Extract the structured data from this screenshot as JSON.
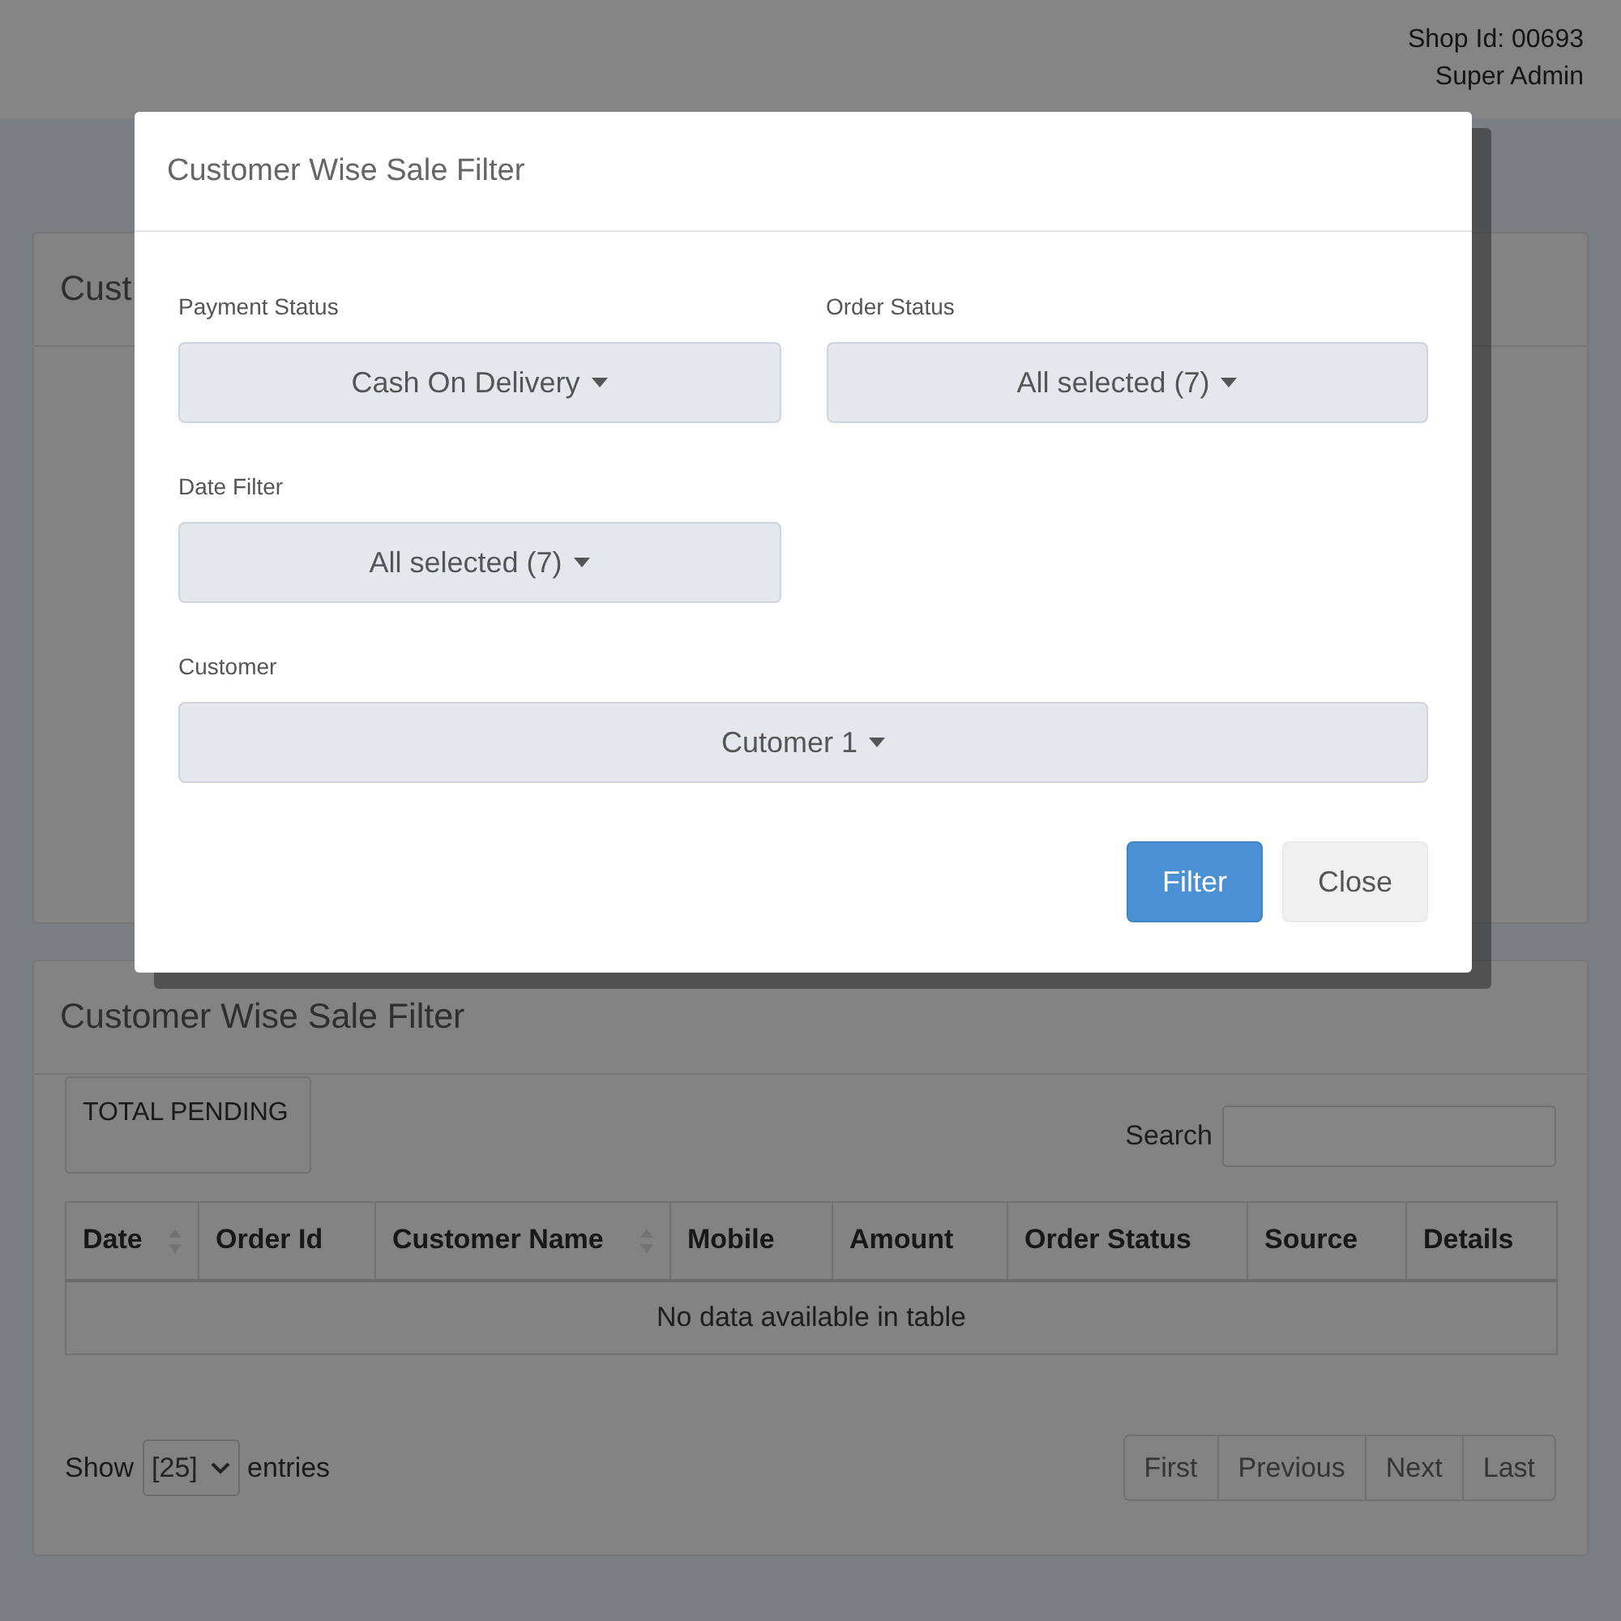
{
  "header": {
    "shop_id": "Shop Id: 00693",
    "role": "Super Admin"
  },
  "background_card": {
    "title": "Cust"
  },
  "report": {
    "title": "Customer Wise Sale Filter",
    "summary": "TOTAL PENDING",
    "search": {
      "label": "Search"
    },
    "table": {
      "columns": [
        {
          "label": "Date",
          "sortable": true
        },
        {
          "label": "Order Id",
          "sortable": false
        },
        {
          "label": "Customer Name",
          "sortable": true
        },
        {
          "label": "Mobile",
          "sortable": false
        },
        {
          "label": "Amount",
          "sortable": false
        },
        {
          "label": "Order Status",
          "sortable": false
        },
        {
          "label": "Source",
          "sortable": false
        },
        {
          "label": "Details",
          "sortable": false
        }
      ],
      "empty_message": "No data available in table"
    },
    "page_size": {
      "prefix": "Show",
      "value": "[25]",
      "suffix": "entries"
    },
    "pagination": [
      "First",
      "Previous",
      "Next",
      "Last"
    ]
  },
  "modal": {
    "title": "Customer Wise Sale Filter",
    "fields": [
      {
        "label": "Payment Status",
        "value": "Cash On Delivery",
        "wide": false
      },
      {
        "label": "Order Status",
        "value": "All selected (7)",
        "wide": false
      },
      {
        "label": "Date Filter",
        "value": "All selected (7)",
        "wide": false
      },
      {
        "label": "Customer",
        "value": "Cutomer 1",
        "wide": true
      }
    ],
    "buttons": [
      {
        "label": "Filter",
        "kind": "primary"
      },
      {
        "label": "Close",
        "kind": "secondary"
      }
    ]
  }
}
